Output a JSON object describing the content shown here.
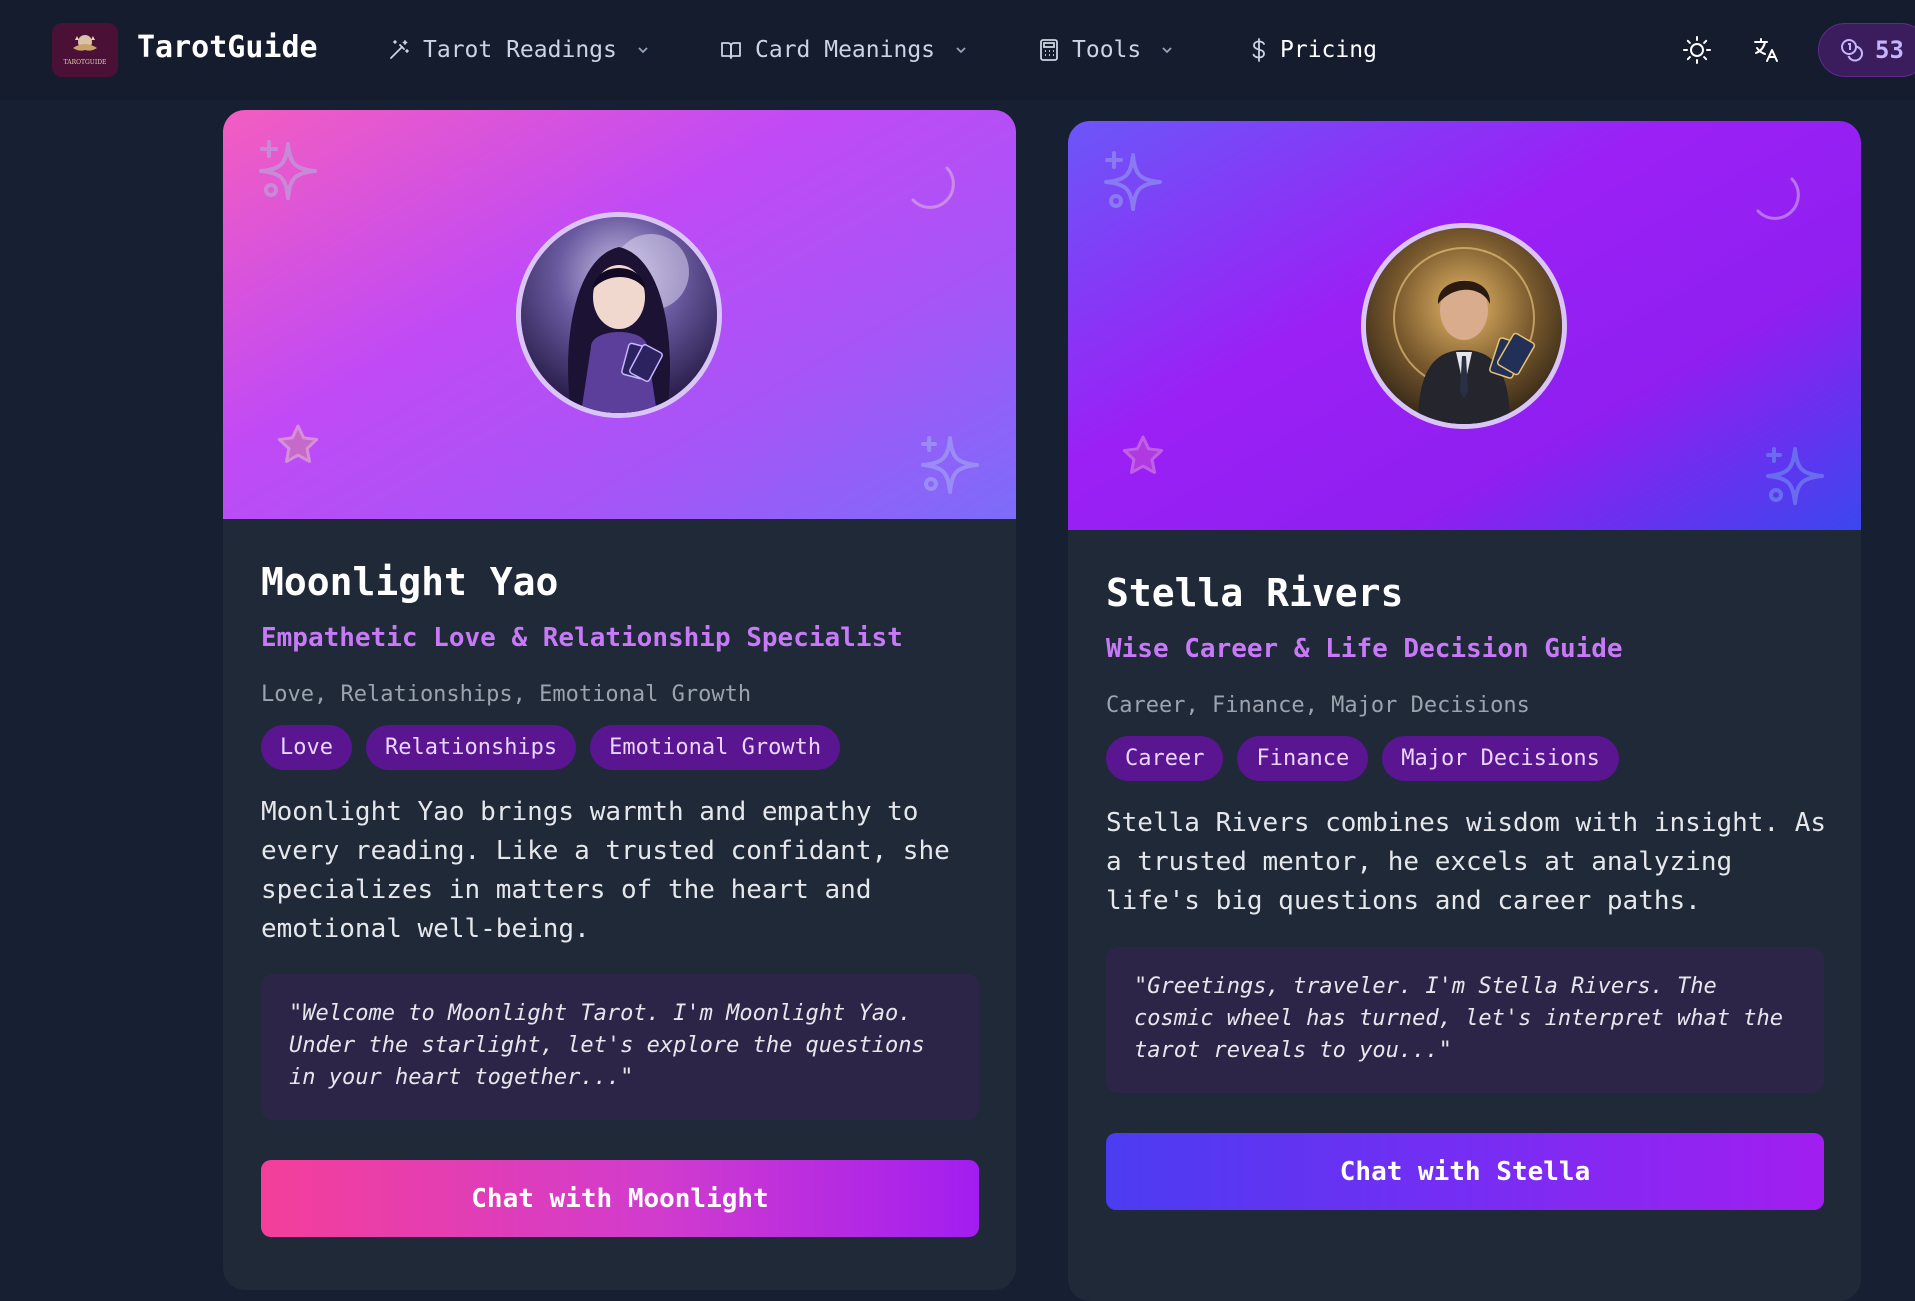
{
  "header": {
    "brand": "TarotGuide",
    "logo_text": "TAROTGUIDE",
    "nav": [
      {
        "label": "Tarot Readings",
        "icon": "magic-wand-icon",
        "has_dropdown": true
      },
      {
        "label": "Card Meanings",
        "icon": "book-icon",
        "has_dropdown": true
      },
      {
        "label": "Tools",
        "icon": "calculator-icon",
        "has_dropdown": true
      },
      {
        "label": "Pricing",
        "icon": "dollar-icon",
        "has_dropdown": false
      }
    ],
    "theme_toggle_icon": "sun-icon",
    "language_icon": "translate-icon",
    "credits": {
      "icon": "coins-icon",
      "value": "53"
    }
  },
  "readers": [
    {
      "name": "Moonlight Yao",
      "title": "Empathetic Love & Relationship Specialist",
      "specialties": "Love, Relationships, Emotional Growth",
      "tags": [
        "Love",
        "Relationships",
        "Emotional Growth"
      ],
      "description": "Moonlight Yao brings warmth and empathy to every reading. Like a trusted confidant, she specializes in matters of the heart and emotional well-being.",
      "quote": "\"Welcome to Moonlight Tarot. I'm Moonlight Yao. Under the starlight, let's explore the questions in your heart together...\"",
      "cta": "Chat with Moonlight"
    },
    {
      "name": "Stella Rivers",
      "title": "Wise Career & Life Decision Guide",
      "specialties": "Career, Finance, Major Decisions",
      "tags": [
        "Career",
        "Finance",
        "Major Decisions"
      ],
      "description": "Stella Rivers combines wisdom with insight. As a trusted mentor, he excels at analyzing life's big questions and career paths.",
      "quote": "\"Greetings, traveler. I'm Stella Rivers. The cosmic wheel has turned, let's interpret what the tarot reveals to you...\"",
      "cta": "Chat with Stella"
    }
  ],
  "colors": {
    "page_bg": "#172033",
    "header_bg": "#141c2e",
    "card_bg": "#1f2937",
    "accent_purple": "#c879f8",
    "tag_bg": "#5a1591"
  }
}
